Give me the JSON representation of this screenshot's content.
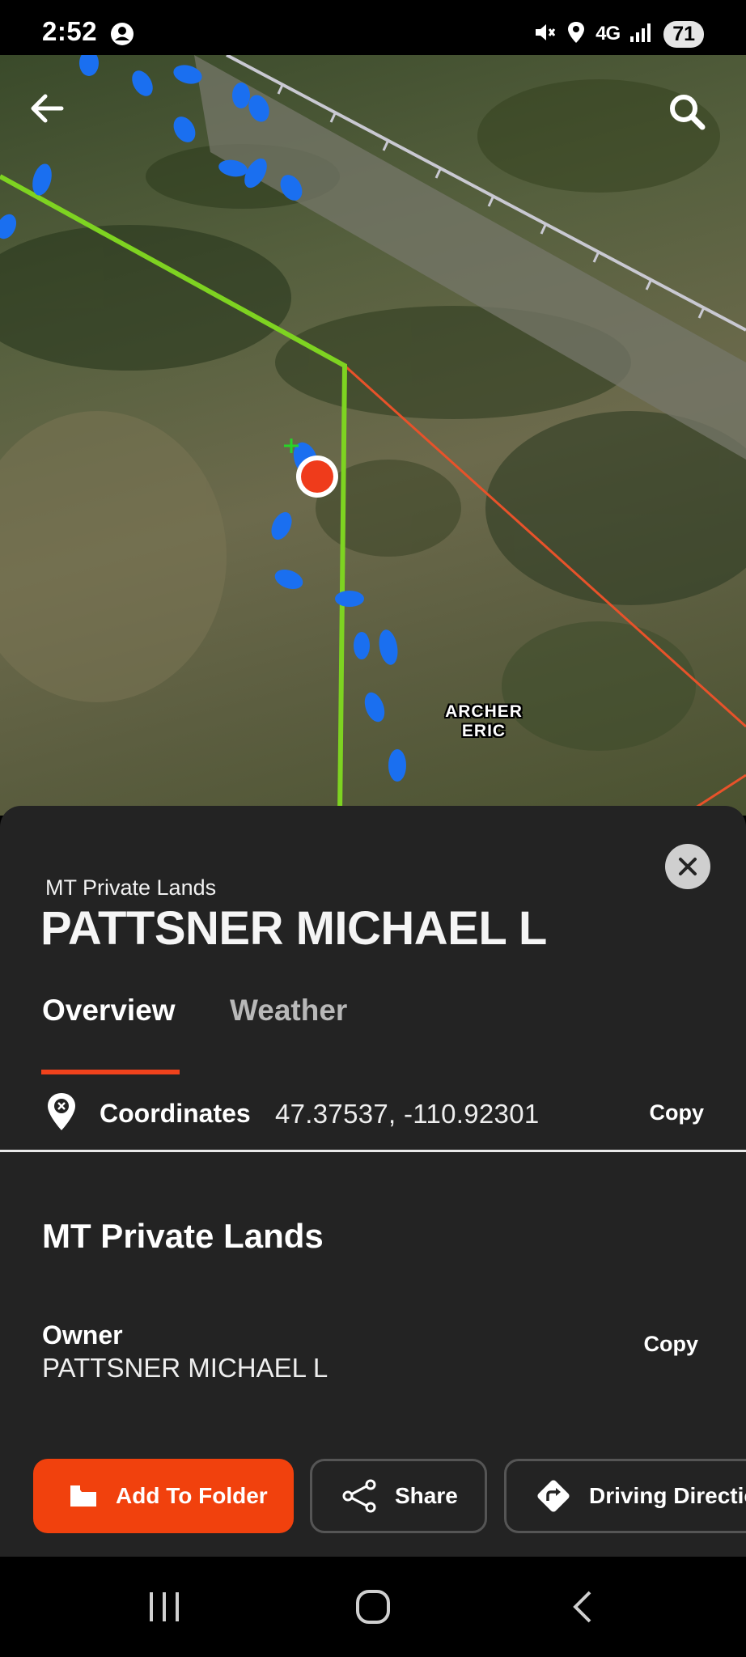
{
  "status_bar": {
    "time": "2:52",
    "network": "4G",
    "battery": "71",
    "icons": [
      "account-circle-icon",
      "mute-icon",
      "location-icon",
      "signal-icon"
    ]
  },
  "map": {
    "labels": [
      "ARCHER",
      "ERIC"
    ],
    "colors": {
      "selected_boundary": "#7ed321",
      "parcel_boundary": "#e8522a",
      "track_points": "#1a6ff0",
      "location_marker": "#ef3b1b"
    }
  },
  "sheet": {
    "subtitle": "MT Private Lands",
    "title": "PATTSNER MICHAEL L",
    "tabs": [
      {
        "label": "Overview",
        "active": true
      },
      {
        "label": "Weather",
        "active": false
      }
    ],
    "coordinates": {
      "label": "Coordinates",
      "value": "47.37537, -110.92301",
      "copy_label": "Copy"
    },
    "section_title": "MT Private Lands",
    "owner": {
      "label": "Owner",
      "value": "PATTSNER MICHAEL L",
      "copy_label": "Copy"
    },
    "actions": {
      "add_to_folder": "Add To Folder",
      "share": "Share",
      "driving_directions": "Driving Directions"
    }
  },
  "accent_color": "#f1410d"
}
